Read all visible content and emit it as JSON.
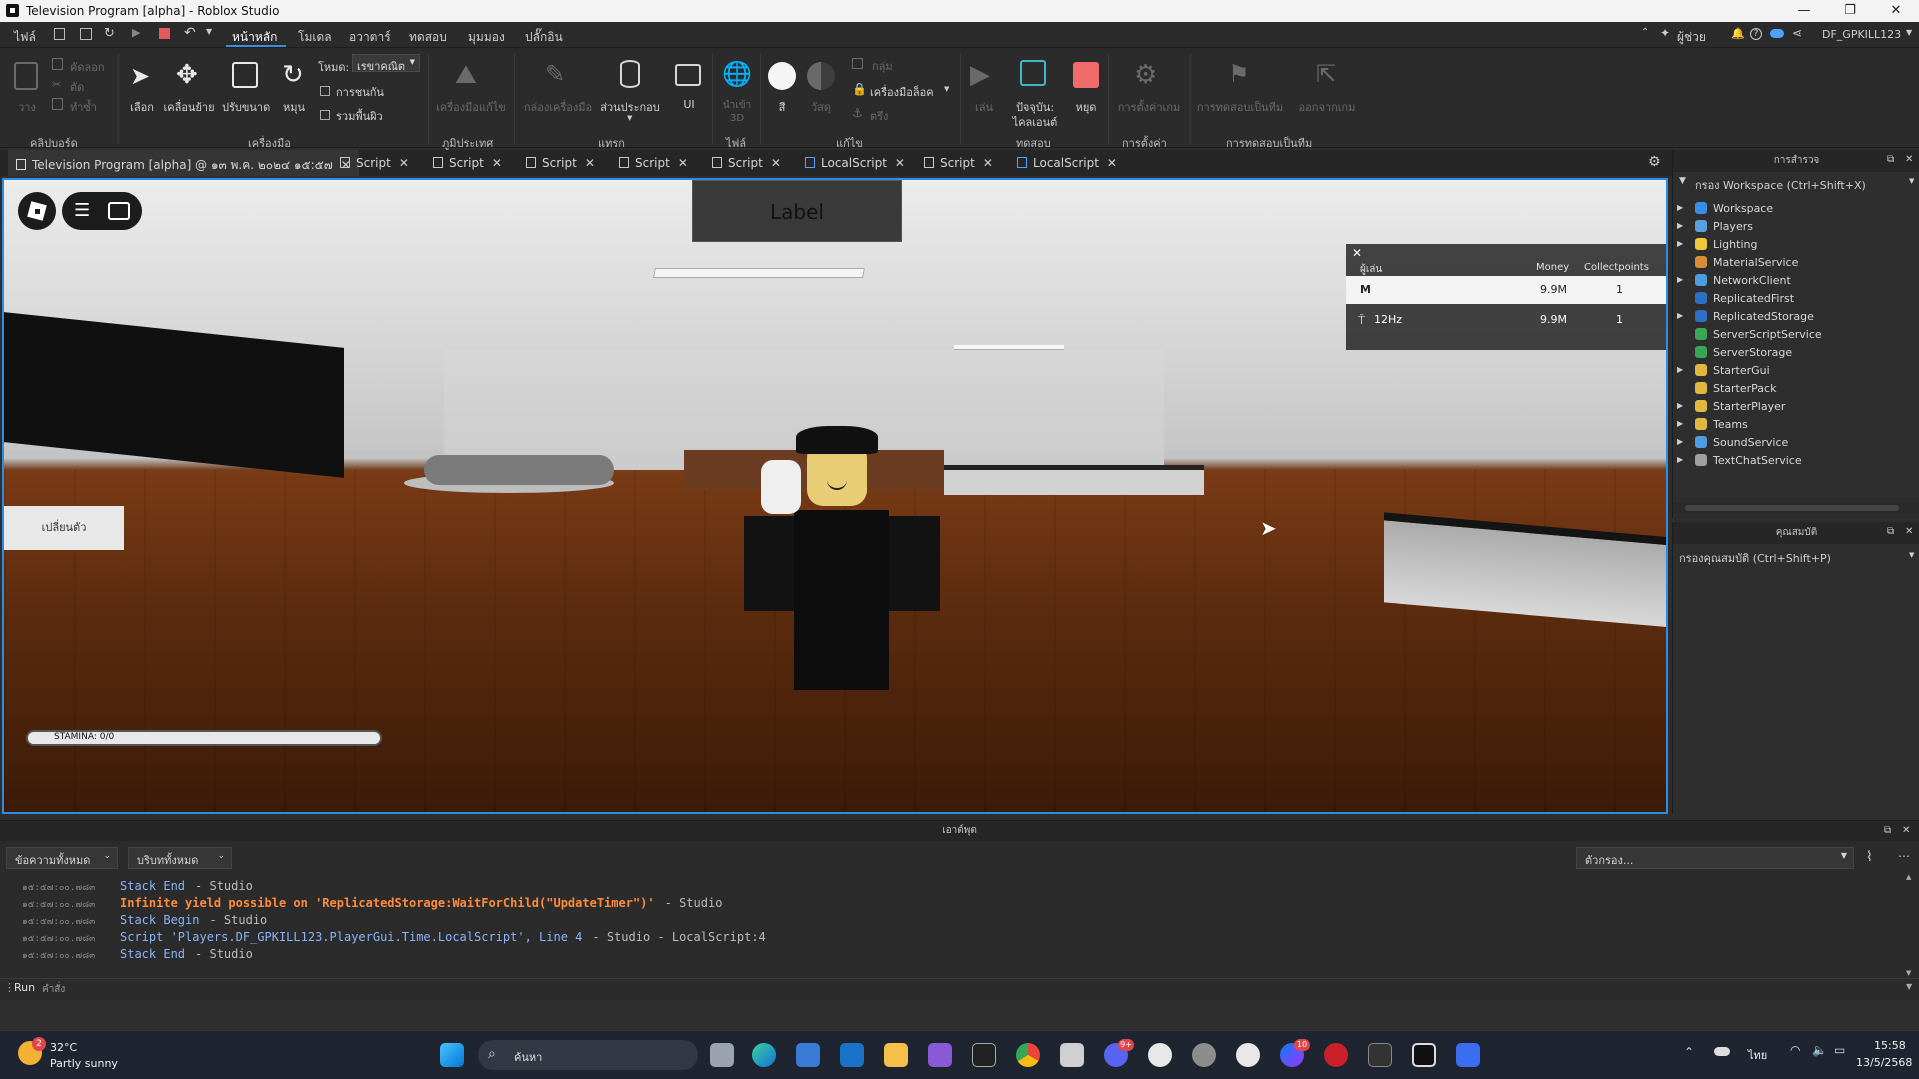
{
  "window": {
    "title": "Television Program [alpha] - Roblox Studio",
    "min": "—",
    "max": "❐",
    "close": "✕"
  },
  "menu": {
    "file": "ไฟล์",
    "items": [
      "หน้าหลัก",
      "โมเดล",
      "อวาตาร์",
      "ทดสอบ",
      "มุมมอง",
      "ปลั๊กอิน"
    ],
    "help": "ผู้ช่วย",
    "user": "DF_GPKILL123"
  },
  "ribbon": {
    "clipboard": {
      "paste": "วาง",
      "copy": "คัดลอก",
      "cut": "ตัด",
      "duplicate": "ทำซ้ำ",
      "group": "คลิปบอร์ด"
    },
    "tools": {
      "select": "เลือก",
      "move": "เคลื่อนย้าย",
      "scale": "ปรับขนาด",
      "rotate": "หมุน",
      "mode_label": "โหมด:",
      "mode_value": "เรขาคณิต",
      "collisions": "การชนกัน",
      "join_surfaces": "รวมพื้นผิว",
      "group": "เครื่องมือ"
    },
    "terrain": {
      "editor": "เครื่องมือแก้ไข",
      "group": "ภูมิประเทศ"
    },
    "insert": {
      "toolbox": "กล่องเครื่องมือ",
      "part": "ส่วนประกอบ",
      "ui": "UI",
      "group": "แทรก"
    },
    "file": {
      "import3d": "นำเข้า 3D",
      "group": "ไฟล์"
    },
    "edit": {
      "color": "สี",
      "material": "วัสดุ",
      "group_btn": "กลุ่ม",
      "lock": "เครื่องมือล็อค",
      "anchor": "ตรึง",
      "group": "แก้ไข"
    },
    "test": {
      "play": "เล่น",
      "current": "ปัจจุบัน:",
      "client": "ไคลเอนต์",
      "stop": "หยุด",
      "group": "ทดสอบ"
    },
    "settings": {
      "game_settings": "การตั้งค่าเกม",
      "group": "การตั้งค่า"
    },
    "team_test": {
      "team_test": "การทดสอบเป็นทีม",
      "exit": "ออกจากเกม",
      "group": "การทดสอบเป็นทีม"
    }
  },
  "tabs": [
    {
      "label": "Television Program [alpha] @ ๑๓ พ.ค. ๒๐๒๔ ๑๕:๕๗"
    },
    {
      "label": "Script"
    },
    {
      "label": "Script"
    },
    {
      "label": "Script"
    },
    {
      "label": "Script"
    },
    {
      "label": "Script"
    },
    {
      "label": "LocalScript"
    },
    {
      "label": "Script"
    },
    {
      "label": "LocalScript"
    }
  ],
  "game": {
    "label_text": "Label",
    "leaderboard": {
      "col_player": "ผู้เล่น",
      "col_money": "Money",
      "col_collect": "Collectpoints",
      "rows": [
        {
          "name": "M",
          "money": "9.9M",
          "points": "1"
        },
        {
          "name": "12Hz",
          "money": "9.9M",
          "points": "1"
        }
      ]
    },
    "change_button": "เปลี่ยนตัว",
    "stamina_label": "STAMINA: 0/0",
    "stamina_fraction": 1.0
  },
  "explorer": {
    "title": "การสำรวจ",
    "filter": "กรอง Workspace (Ctrl+Shift+X)",
    "items": [
      {
        "name": "Workspace",
        "arrow": "▶",
        "color": "#3b8ee8"
      },
      {
        "name": "Players",
        "arrow": "▶",
        "color": "#5aa0e0"
      },
      {
        "name": "Lighting",
        "arrow": "▶",
        "color": "#f0c93a"
      },
      {
        "name": "MaterialService",
        "arrow": "",
        "color": "#d98c3a"
      },
      {
        "name": "NetworkClient",
        "arrow": "▶",
        "color": "#4d9de0"
      },
      {
        "name": "ReplicatedFirst",
        "arrow": "",
        "color": "#2d6fc2"
      },
      {
        "name": "ReplicatedStorage",
        "arrow": "▶",
        "color": "#2d6fc2"
      },
      {
        "name": "ServerScriptService",
        "arrow": "",
        "color": "#3aa655"
      },
      {
        "name": "ServerStorage",
        "arrow": "",
        "color": "#3aa655"
      },
      {
        "name": "StarterGui",
        "arrow": "▶",
        "color": "#e0b840"
      },
      {
        "name": "StarterPack",
        "arrow": "",
        "color": "#e0b840"
      },
      {
        "name": "StarterPlayer",
        "arrow": "▶",
        "color": "#e0b840"
      },
      {
        "name": "Teams",
        "arrow": "▶",
        "color": "#e0b840"
      },
      {
        "name": "SoundService",
        "arrow": "▶",
        "color": "#4d9de0"
      },
      {
        "name": "TextChatService",
        "arrow": "▶",
        "color": "#a0a0a0"
      }
    ]
  },
  "properties": {
    "title": "คุณสมบัติ",
    "filter": "กรองคุณสมบัติ (Ctrl+Shift+P)"
  },
  "output": {
    "title": "เอาต์พุต",
    "filter_all_messages": "ข้อความทั้งหมด",
    "filter_all_contexts": "บริบททั้งหมด",
    "filter_placeholder": "ตัวกรอง...",
    "lines": [
      {
        "time": "๑๕:๕๗:๐๐.๗๘๓",
        "text": "Stack End",
        "source": "-  Studio",
        "style": "blue"
      },
      {
        "time": "๑๕:๕๗:๐๐.๗๘๓",
        "text": "Infinite yield possible on 'ReplicatedStorage:WaitForChild(\"UpdateTimer\")'",
        "source": "-  Studio",
        "style": "orange"
      },
      {
        "time": "๑๕:๕๗:๐๐.๗๘๓",
        "text": "Stack Begin",
        "source": "-  Studio",
        "style": "blue"
      },
      {
        "time": "๑๕:๕๗:๐๐.๗๘๓",
        "text": "Script 'Players.DF_GPKILL123.PlayerGui.Time.LocalScript', Line 4",
        "source": "-  Studio - LocalScript:4",
        "style": "blue"
      },
      {
        "time": "๑๕:๕๗:๐๐.๗๘๓",
        "text": "Stack End",
        "source": "-  Studio",
        "style": "blue"
      }
    ],
    "command_label": "Run",
    "command_placeholder": "คำสั่ง"
  },
  "taskbar": {
    "weather_temp": "32°C",
    "weather_desc": "Partly sunny",
    "weather_badge": "2",
    "search": "ค้นหา",
    "language": "ไทย",
    "time": "15:58",
    "date": "13/5/2568",
    "messenger_badge": "10",
    "discord_badge": "9+"
  }
}
